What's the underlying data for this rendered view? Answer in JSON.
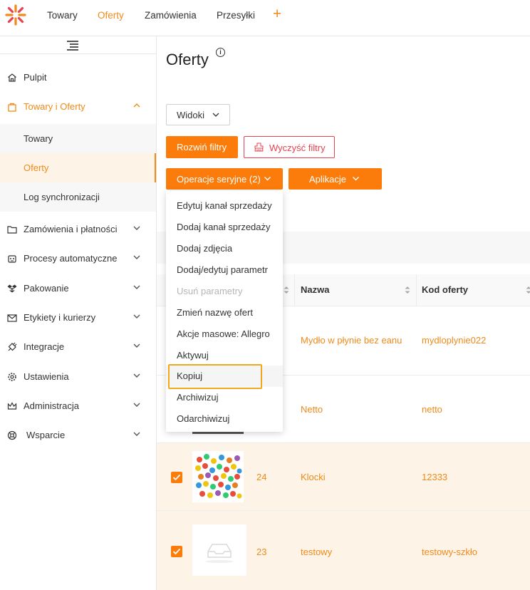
{
  "topnav": {
    "items": [
      {
        "label": "Towary"
      },
      {
        "label": "Oferty",
        "active": true
      },
      {
        "label": "Zamówienia"
      },
      {
        "label": "Przesyłki"
      }
    ],
    "add_label": "+"
  },
  "sidebar": {
    "items": [
      {
        "label": "Pulpit",
        "icon": "home-icon"
      },
      {
        "label": "Towary i Oferty",
        "icon": "bag-icon",
        "open": true
      },
      {
        "label": "Zamówienia i płatności",
        "icon": "folder-icon"
      },
      {
        "label": "Procesy automatyczne",
        "icon": "robot-icon"
      },
      {
        "label": "Pakowanie",
        "icon": "dropbox-icon"
      },
      {
        "label": "Etykiety i kurierzy",
        "icon": "envelope-icon"
      },
      {
        "label": "Integracje",
        "icon": "plug-icon"
      },
      {
        "label": "Ustawienia",
        "icon": "gear-icon"
      },
      {
        "label": "Administracja",
        "icon": "crown-icon"
      },
      {
        "label": "Wsparcie",
        "icon": "lifebuoy-icon"
      }
    ],
    "subitems": [
      {
        "label": "Towary"
      },
      {
        "label": "Oferty",
        "active": true
      },
      {
        "label": "Log synchronizacji"
      }
    ]
  },
  "page": {
    "title": "Oferty",
    "views_label": "Widoki",
    "expand_filters_label": "Rozwiń filtry",
    "clear_filters_label": "Wyczyść filtry",
    "bulk_ops_label": "Operacje seryjne (2)",
    "apps_label": "Aplikacje"
  },
  "dropdown": {
    "items": [
      {
        "label": "Edytuj kanał sprzedaży"
      },
      {
        "label": "Dodaj kanał sprzedaży"
      },
      {
        "label": "Dodaj zdjęcia"
      },
      {
        "label": "Dodaj/edytuj parametr"
      },
      {
        "label": "Usuń parametry",
        "disabled": true
      },
      {
        "label": "Zmień nazwę ofert"
      },
      {
        "label": "Akcje masowe: Allegro"
      },
      {
        "label": "Aktywuj"
      },
      {
        "label": "Kopiuj",
        "highlighted": true
      },
      {
        "label": "Archiwizuj"
      },
      {
        "label": "Odarchiwizuj"
      }
    ]
  },
  "table": {
    "columns": [
      "Nazwa",
      "Kod oferty"
    ],
    "rows": [
      {
        "id": "",
        "name": "Mydło w płynie bez eanu",
        "code": "mydloplynie022",
        "selected": false
      },
      {
        "id": "",
        "name": "Netto",
        "code": "netto",
        "selected": false
      },
      {
        "id": "24",
        "name": "Klocki",
        "code": "12333",
        "selected": true
      },
      {
        "id": "23",
        "name": "testowy",
        "code": "testowy-szkło",
        "selected": true
      }
    ]
  },
  "colors": {
    "accent": "#fb7c0b",
    "link": "#f08a1a",
    "danger": "#e8414f",
    "highlight": "#f2a81d",
    "selected_row": "#fdf3e6"
  }
}
